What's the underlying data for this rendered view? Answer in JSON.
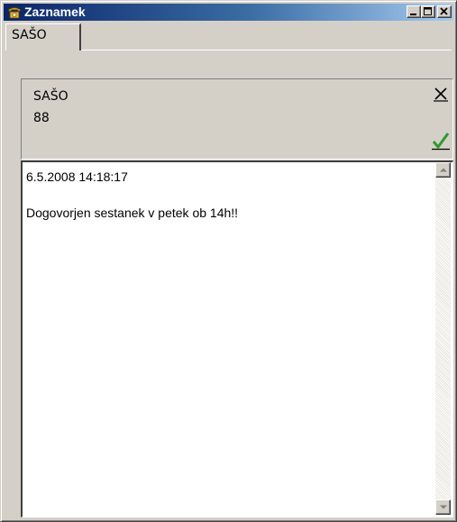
{
  "window": {
    "title": "Zaznamek",
    "icon": "telephone-icon",
    "controls": [
      "minimize-icon",
      "maximize-icon",
      "close-icon"
    ]
  },
  "tabs": [
    {
      "label": "SAŠO",
      "active": true
    }
  ],
  "contact": {
    "name": "SAŠO",
    "number": "88",
    "close_icon": "close-x-icon",
    "confirm_icon": "checkmark-icon"
  },
  "note": {
    "timestamp": "6.5.2008 14:18:17",
    "blank": "",
    "text": "Dogovorjen sestanek v petek ob 14h!!"
  },
  "colors": {
    "titlebar_start": "#0a246a",
    "titlebar_end": "#a6caf0",
    "face": "#d4d0c8",
    "check": "#2a9d2a"
  }
}
